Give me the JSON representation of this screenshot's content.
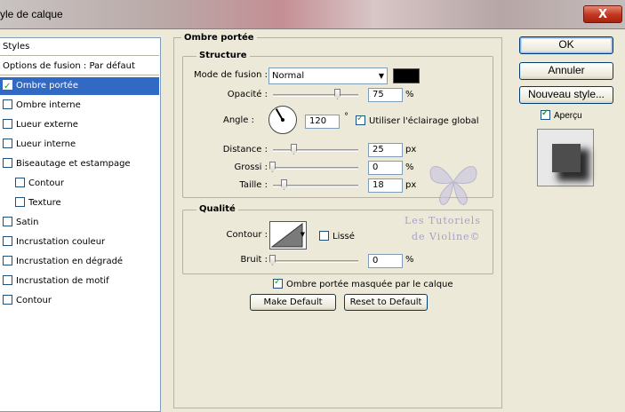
{
  "window": {
    "title": "Style de calque",
    "visible_title": "yle de calque",
    "close_label": "X"
  },
  "styles_list": {
    "header": "Styles",
    "blending_options": "Options de fusion : Par défaut",
    "items": [
      {
        "label": "Ombre portée",
        "checked": true,
        "selected": true,
        "indent": false
      },
      {
        "label": "Ombre interne",
        "checked": false,
        "selected": false,
        "indent": false
      },
      {
        "label": "Lueur externe",
        "checked": false,
        "selected": false,
        "indent": false
      },
      {
        "label": "Lueur interne",
        "checked": false,
        "selected": false,
        "indent": false
      },
      {
        "label": "Biseautage et estampage",
        "checked": false,
        "selected": false,
        "indent": false
      },
      {
        "label": "Contour",
        "checked": false,
        "selected": false,
        "indent": true
      },
      {
        "label": "Texture",
        "checked": false,
        "selected": false,
        "indent": true
      },
      {
        "label": "Satin",
        "checked": false,
        "selected": false,
        "indent": false
      },
      {
        "label": "Incrustation couleur",
        "checked": false,
        "selected": false,
        "indent": false
      },
      {
        "label": "Incrustation en dégradé",
        "checked": false,
        "selected": false,
        "indent": false
      },
      {
        "label": "Incrustation de motif",
        "checked": false,
        "selected": false,
        "indent": false
      },
      {
        "label": "Contour",
        "checked": false,
        "selected": false,
        "indent": false
      }
    ]
  },
  "panel": {
    "title": "Ombre portée",
    "structure": {
      "title": "Structure",
      "blend_mode_label": "Mode de fusion :",
      "blend_mode_value": "Normal",
      "shadow_color": "#000000",
      "opacity_label": "Opacité :",
      "opacity_value": "75",
      "opacity_unit": "%",
      "opacity_level": 0.75,
      "angle_label": "Angle :",
      "angle_value": "120",
      "angle_unit": "°",
      "global_light_label": "Utiliser l'éclairage global",
      "global_light_checked": true,
      "distance_label": "Distance :",
      "distance_value": "25",
      "distance_unit": "px",
      "spread_label": "Grossi :",
      "spread_value": "0",
      "spread_unit": "%",
      "size_label": "Taille :",
      "size_value": "18",
      "size_unit": "px"
    },
    "quality": {
      "title": "Qualité",
      "contour_label": "Contour :",
      "antialias_label": "Lissé",
      "antialias_checked": false,
      "noise_label": "Bruit :",
      "noise_value": "0",
      "noise_unit": "%"
    },
    "knockout_label": "Ombre portée masquée par le calque",
    "knockout_checked": true,
    "make_default": "Make Default",
    "reset_default": "Reset to Default"
  },
  "actions": {
    "ok": "OK",
    "cancel": "Annuler",
    "new_style": "Nouveau style...",
    "preview_label": "Aperçu",
    "preview_checked": true
  },
  "watermark": {
    "line1": "Les Tutoriels",
    "line2": "de Violine©"
  }
}
